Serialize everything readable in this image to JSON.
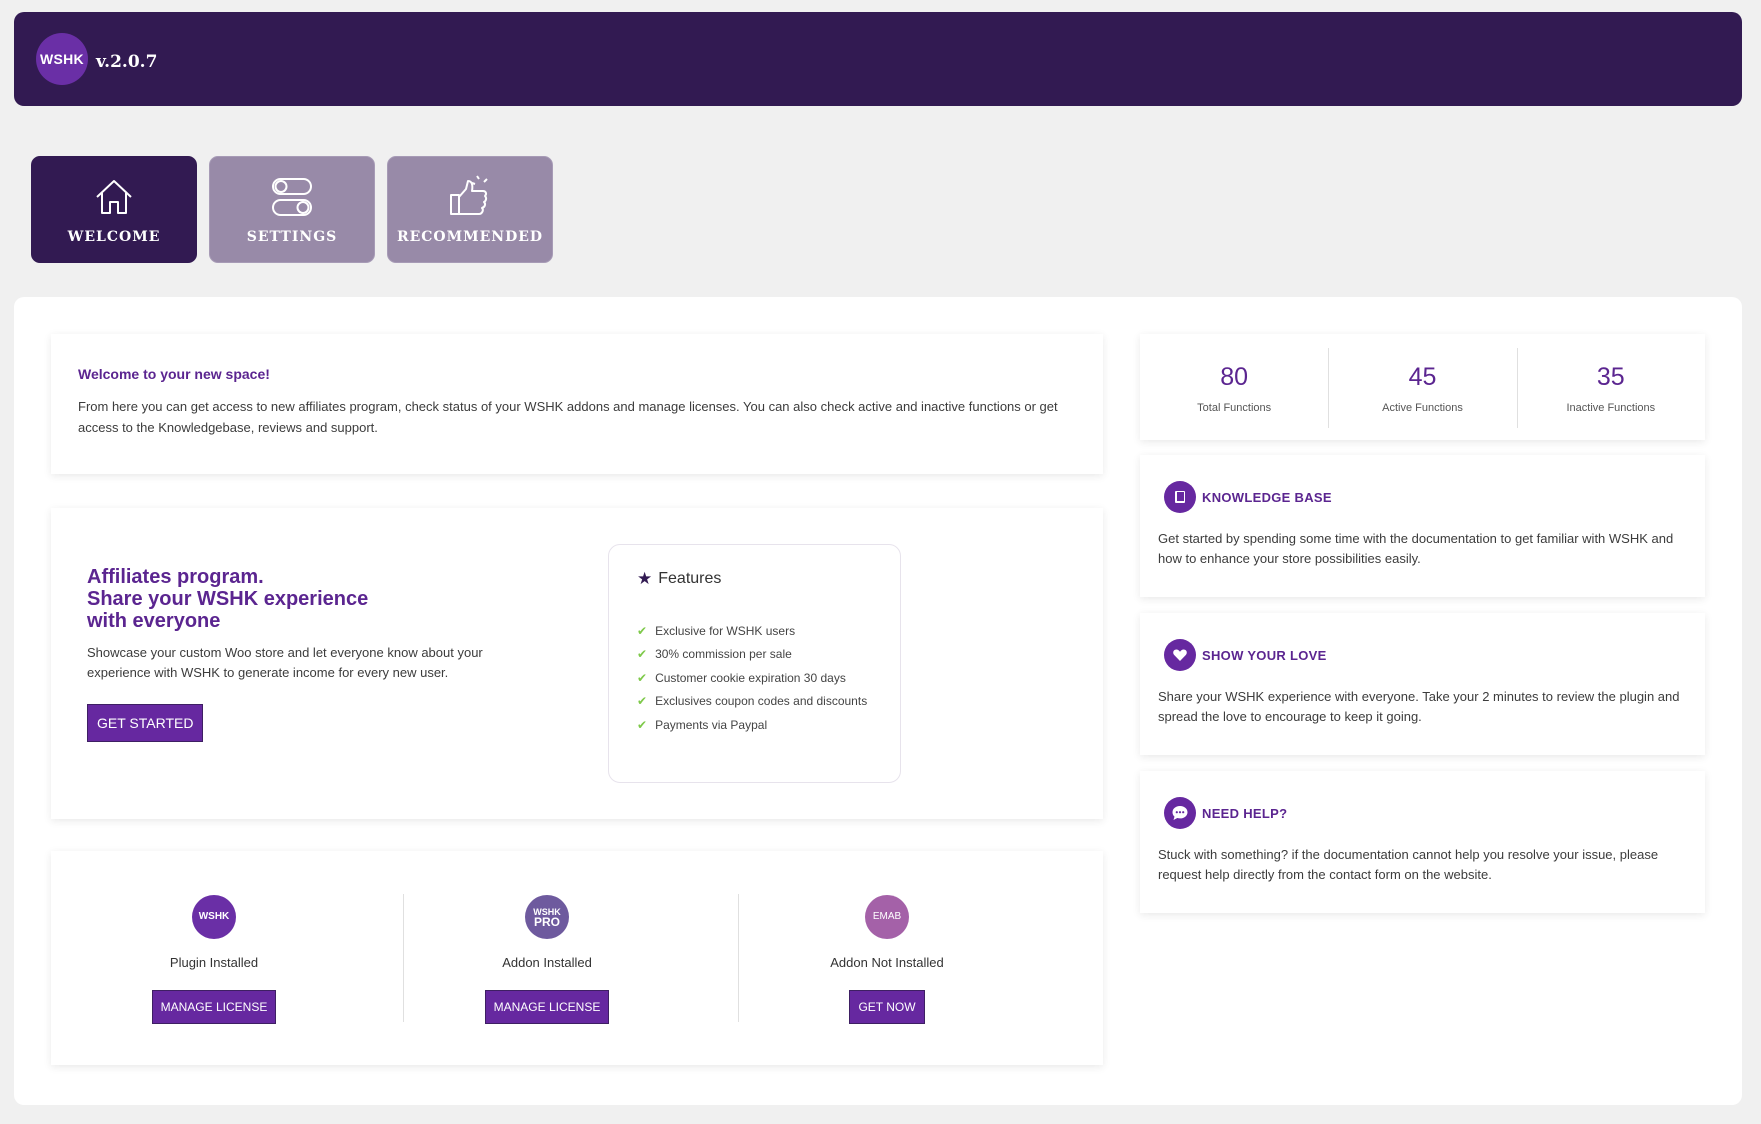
{
  "header": {
    "logo_text": "WSHK",
    "version": "v.2.0.7"
  },
  "tabs": [
    {
      "label": "WELCOME",
      "icon": "home-icon",
      "active": true
    },
    {
      "label": "SETTINGS",
      "icon": "toggles-icon",
      "active": false
    },
    {
      "label": "RECOMMENDED",
      "icon": "thumbs-up-icon",
      "active": false
    }
  ],
  "welcome": {
    "title": "Welcome to your new space!",
    "text": "From here you can get access to new affiliates program, check status of your WSHK addons and manage licenses. You can also check active and inactive functions or get access to the Knowledgebase, reviews and support."
  },
  "affiliates": {
    "title_line1": "Affiliates program.",
    "title_line2": "Share your WSHK experience",
    "title_line3": "with everyone",
    "description": "Showcase your custom Woo store and let everyone know about your experience with WSHK to generate income for every new user.",
    "button": "GET STARTED",
    "features_title": "Features",
    "features": [
      "Exclusive for WSHK users",
      "30% commission per sale",
      "Customer cookie expiration 30 days",
      "Exclusives coupon codes and discounts",
      "Payments via Paypal"
    ]
  },
  "addons": [
    {
      "logo": "WSHK",
      "status": "Plugin Installed",
      "button": "MANAGE LICENSE",
      "color": "#6a2fa6"
    },
    {
      "logo_line1": "WSHK",
      "logo_line2": "PRO",
      "status": "Addon Installed",
      "button": "MANAGE LICENSE",
      "color": "#6e5a9e"
    },
    {
      "logo": "EMAB",
      "status": "Addon Not Installed",
      "button": "GET NOW",
      "color": "#a461a8"
    }
  ],
  "stats": [
    {
      "value": "80",
      "label": "Total Functions"
    },
    {
      "value": "45",
      "label": "Active Functions"
    },
    {
      "value": "35",
      "label": "Inactive Functions"
    }
  ],
  "info_cards": [
    {
      "icon": "book-icon",
      "title": "KNOWLEDGE BASE",
      "text": "Get started by spending some time with the documentation to get familiar with WSHK and how to enhance your store possibilities easily."
    },
    {
      "icon": "heart-icon",
      "title": "SHOW YOUR LOVE",
      "text": "Share your WSHK experience with everyone. Take your 2 minutes to review the plugin and spread the love to encourage to keep it going."
    },
    {
      "icon": "chat-icon",
      "title": "NEED HELP?",
      "text": "Stuck with something? if the documentation cannot help you resolve your issue, please request help directly from the contact form on the website."
    }
  ],
  "colors": {
    "header_bg": "#321a52",
    "accent": "#5b2590",
    "button": "#6628a0",
    "tab_inactive": "#988aa8",
    "check": "#7ec94a"
  }
}
